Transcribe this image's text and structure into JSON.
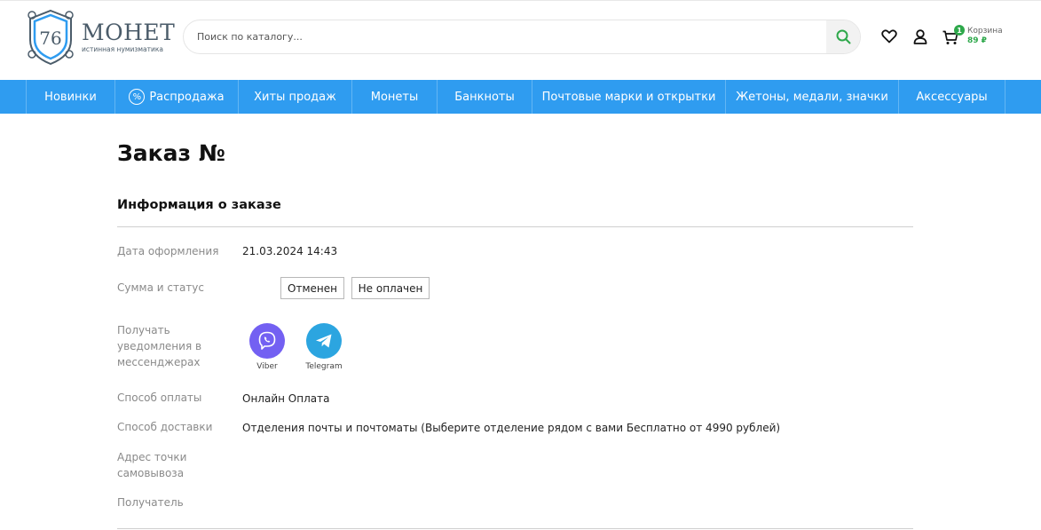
{
  "header": {
    "logo": {
      "number": "76",
      "title": "МОНЕТ",
      "subtitle": "истинная нумизматика"
    },
    "search": {
      "placeholder": "Поиск по каталогу..."
    },
    "cart": {
      "badge": "1",
      "label": "Корзина",
      "price": "89 ₽"
    }
  },
  "nav": {
    "items": [
      {
        "label": "Новинки"
      },
      {
        "label": "Распродажа",
        "icon": "%"
      },
      {
        "label": "Хиты продаж"
      },
      {
        "label": "Монеты"
      },
      {
        "label": "Банкноты"
      },
      {
        "label": "Почтовые марки и открытки"
      },
      {
        "label": "Жетоны, медали, значки"
      },
      {
        "label": "Аксессуары"
      }
    ]
  },
  "order": {
    "title": "Заказ №",
    "section_title": "Информация о заказе",
    "date_label": "Дата оформления",
    "date_value": "21.03.2024 14:43",
    "sum_label": "Сумма и статус",
    "status_cancelled": "Отменен",
    "status_unpaid": "Не оплачен",
    "notify_label": "Получать уведомления в мессенджерах",
    "messengers": [
      {
        "name": "Viber",
        "icon": "viber-icon",
        "color": "#7360f2"
      },
      {
        "name": "Telegram",
        "icon": "telegram-icon",
        "color": "#2ca5e0"
      }
    ],
    "payment_label": "Способ оплаты",
    "payment_value": "Онлайн Оплата",
    "delivery_label": "Способ доставки",
    "delivery_value": "Отделения почты и почтоматы (Выберите отделение рядом с вами Бесплатно от 4990 рублей)",
    "pickup_label": "Адрес точки самовывоза",
    "recipient_label": "Получатель"
  },
  "colors": {
    "nav_bg": "#2f9cf0",
    "accent_green": "#2ea84b"
  }
}
